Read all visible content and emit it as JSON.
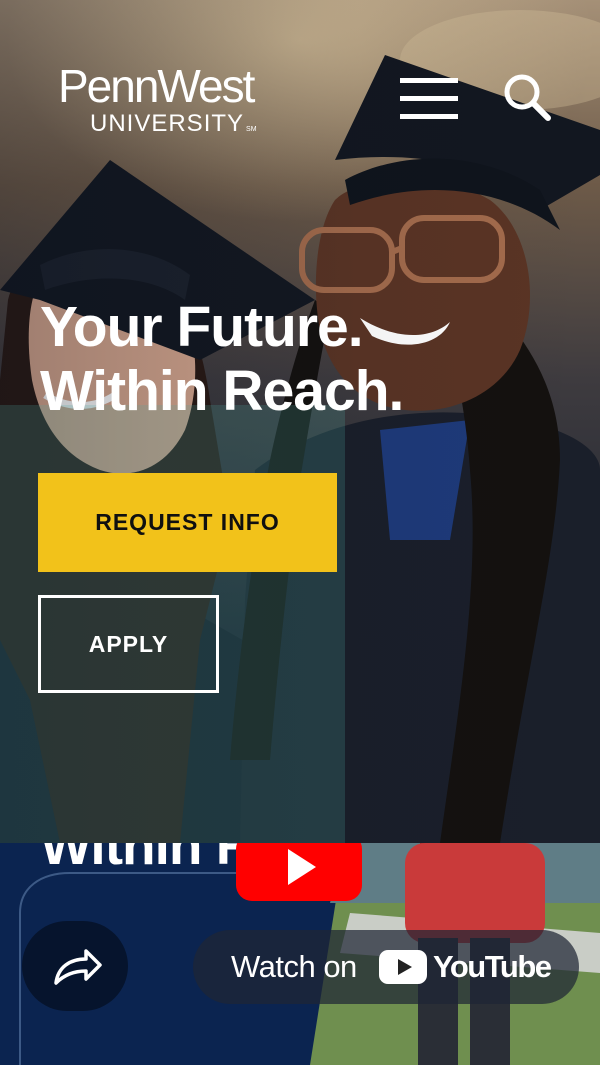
{
  "header": {
    "logo_name": "PennWest",
    "logo_sub": "UNIVERSITY",
    "logo_mark": "SM",
    "menu_icon": "hamburger-menu-icon",
    "search_icon": "search-icon"
  },
  "hero": {
    "headline_line1": "Your Future.",
    "headline_line2": "Within Reach.",
    "request_info_label": "REQUEST INFO",
    "apply_label": "APPLY"
  },
  "video": {
    "title": "Within Re",
    "play_icon": "play-icon",
    "share_icon": "share-arrow-icon",
    "watch_on_label": "Watch on",
    "youtube_label": "YouTube"
  },
  "colors": {
    "accent_yellow": "#f2c21a",
    "navy": "#0b2450",
    "youtube_red": "#ff0000"
  }
}
